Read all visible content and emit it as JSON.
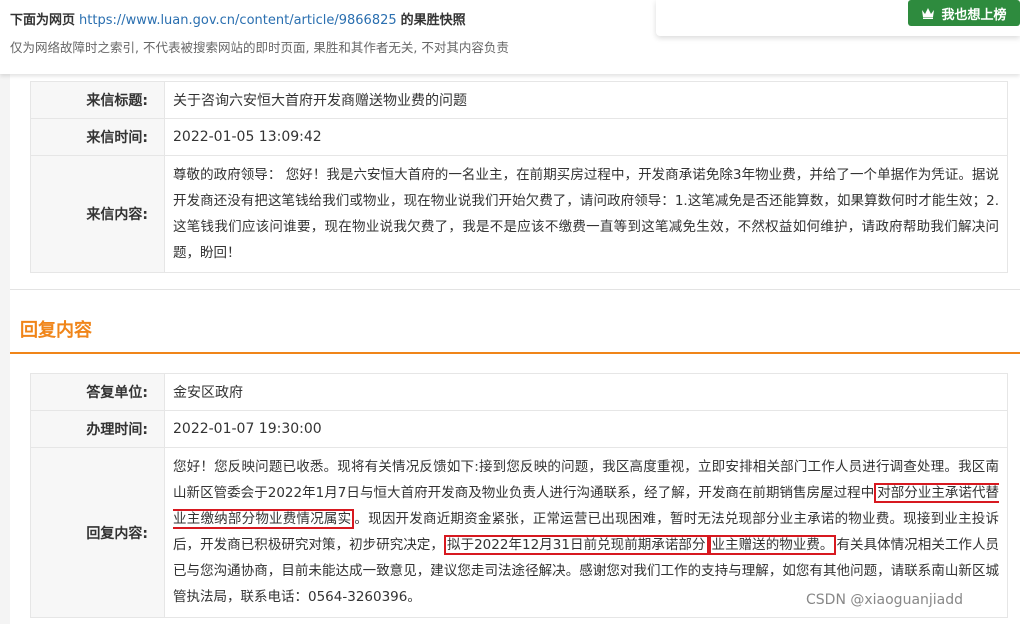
{
  "snapshot": {
    "prefix": "下面为网页",
    "url": "https://www.luan.gov.cn/content/article/9866825",
    "suffix": "的果胜快照",
    "disclaimer": "仅为网络故障时之索引, 不代表被搜索网站的即时页面, 果胜和其作者无关, 不对其内容负责",
    "rank_button": "我也想上榜"
  },
  "letter": {
    "title_label": "来信标题:",
    "title_value": "关于咨询六安恒大首府开发商赠送物业费的问题",
    "time_label": "来信时间:",
    "time_value": "2022-01-05 13:09:42",
    "content_label": "来信内容:",
    "content_value": "尊敬的政府领导： 您好！我是六安恒大首府的一名业主，在前期买房过程中，开发商承诺免除3年物业费，并给了一个单据作为凭证。据说开发商还没有把这笔钱给我们或物业，现在物业说我们开始欠费了，请问政府领导：1.这笔减免是否还能算数，如果算数何时才能生效；2.这笔钱我们应该问谁要，现在物业说我欠费了，我是不是应该不缴费一直等到这笔减免生效，不然权益如何维护，请政府帮助我们解决问题，盼回！"
  },
  "reply_section": {
    "heading": "回复内容",
    "unit_label": "答复单位:",
    "unit_value": "金安区政府",
    "time_label": "办理时间:",
    "time_value": "2022-01-07 19:30:00",
    "content_label": "回复内容:",
    "content_part1": "您好！您反映问题已收悉。现将有关情况反馈如下:接到您反映的问题，我区高度重视，立即安排相关部门工作人员进行调查处理。我区南山新区管委会于2022年1月7日与恒大首府开发商及物业负责人进行沟通联系，经了解，开发商在前期销售房屋过程中",
    "content_highlight1": "对部分业主承诺代替业主缴纳部分物业费情况属实",
    "content_part2": "。现因开发商近期资金紧张，正常运营已出现困难，暂时无法兑现部分业主承诺的物业费。现接到业主投诉后，开发商已积极研究对策，初步研究决定，",
    "content_highlight2a": "拟于2022年12月31日前兑现前期承诺部分",
    "content_highlight2b": "业主赠送的物业费。",
    "content_part3": "有关具体情况相关工作人员已与您沟通协商，目前未能达成一致意见，建议您走司法途径解决。感谢您对我们工作的支持与理解，如您有其他问题，请联系南山新区城管执法局，联系电话：0564-3260396。"
  },
  "watermark": "CSDN @xiaoguanjiadd",
  "colors": {
    "accent_orange": "#f08519",
    "highlight_red": "#d71920",
    "rank_green": "#2e8b3e",
    "link_blue": "#2a6fb0"
  }
}
